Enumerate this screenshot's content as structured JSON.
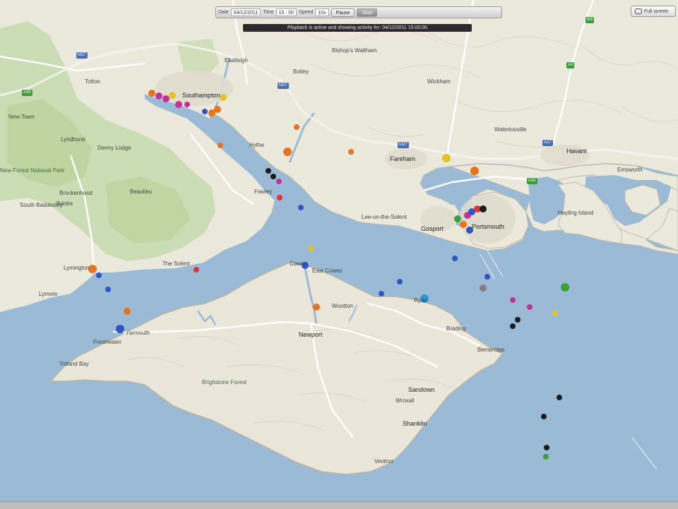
{
  "toolbar": {
    "date_label": "Date",
    "date_value": "04/12/2011",
    "time_label": "Time",
    "time_value": "15 : 00",
    "speed_label": "Speed",
    "speed_value": "10x",
    "pause_label": "Pause",
    "stop_label": "Stop"
  },
  "banner": "Playback is active and showing activity for: 04/12/2011 15:00:00",
  "fullscreen_label": "Full screen",
  "places": {
    "southampton": "Southampton",
    "new_town": "New Town",
    "lyndhurst": "Lyndhurst",
    "denny_lodge": "Denny Lodge",
    "beaulieu": "Beaulieu",
    "south_baddesley": "South Baddesley",
    "boldre": "Boldre",
    "lymington": "Lymington",
    "lymore": "Lymore",
    "brockenhurst": "Brockenhurst",
    "fareham": "Fareham",
    "gosport": "Gosport",
    "portsmouth": "Portsmouth",
    "havant": "Havant",
    "emsworth": "Emsworth",
    "waterlooville": "Waterlooville",
    "wickham": "Wickham",
    "cowes": "Cowes",
    "east_cowes": "East Cowes",
    "newport": "Newport",
    "yarmouth": "Yarmouth",
    "freshwater": "Freshwater",
    "totland": "Totland Bay",
    "ryde": "Ryde",
    "sandown": "Sandown",
    "shanklin": "Shanklin",
    "ventnor": "Ventnor",
    "brighstone": "Brighstone Forest",
    "bembridge": "Bembridge",
    "hayling": "Hayling Island",
    "fawley": "Fawley",
    "hythe": "Hythe",
    "totton": "Totton",
    "eastleigh": "Eastleigh",
    "botley": "Botley",
    "bishops_waltham": "Bishop's Waltham",
    "lee_on_solent": "Lee-on-the-Solent",
    "wootton": "Wootton",
    "wroxall": "Wroxall",
    "brading": "Brading",
    "the_solent": "The Solent",
    "new_forest": "New Forest National Park"
  },
  "roads": {
    "m27": "M27",
    "a27": "A27",
    "a3": "A3",
    "a31": "A31",
    "a35": "A35",
    "m3": "M3",
    "a32": "A32",
    "a326": "A326",
    "a337": "A337"
  },
  "colors": {
    "sea": "#9bbad6",
    "land": "#eceadf",
    "forest": "#c8dbb0",
    "road": "#ffffff",
    "vessel_orange": "#e8731f",
    "vessel_pink": "#c0339b",
    "vessel_blue": "#2f56c5",
    "vessel_black": "#1c1c1c",
    "vessel_yellow": "#e6c229",
    "vessel_green": "#3aa03a",
    "vessel_red": "#d8363a"
  }
}
